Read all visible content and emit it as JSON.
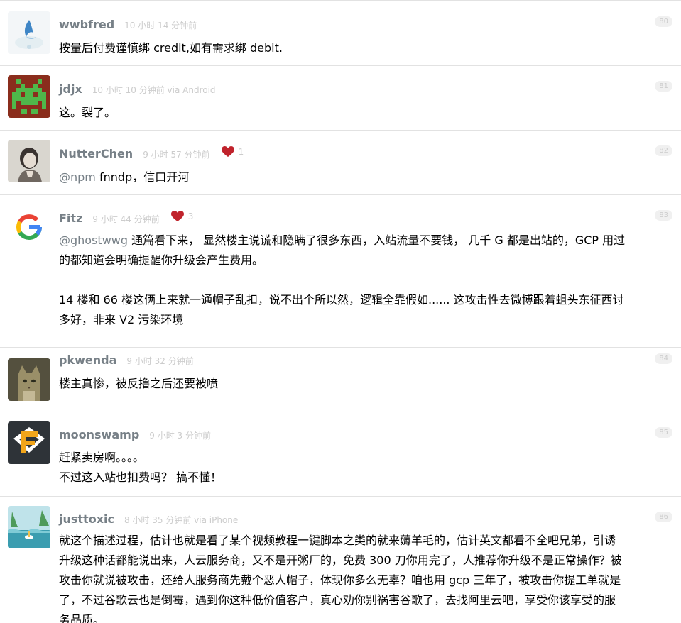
{
  "replies": [
    {
      "username": "wwbfred",
      "time": "10 小时 14 分钟前",
      "floor": "80",
      "content": [
        "按量后付费谨慎绑 credit,如有需求绑 debit."
      ]
    },
    {
      "username": "jdjx",
      "time": "10 小时 10 分钟前 via Android",
      "floor": "81",
      "content": [
        "这。裂了。"
      ]
    },
    {
      "username": "NutterChen",
      "time": "9 小时 57 分钟前",
      "likes": "1",
      "floor": "82",
      "mention": "@npm",
      "content": [
        " fnndp，信口开河"
      ]
    },
    {
      "username": "Fitz",
      "time": "9 小时 44 分钟前",
      "likes": "3",
      "floor": "83",
      "mention": "@ghostwwg",
      "content": [
        " 通篇看下来， 显然楼主说谎和隐瞒了很多东西，入站流量不要钱， 几千 G 都是出站的，GCP 用过",
        "的都知道会明确提醒你升级会产生费用。",
        "",
        "14 楼和 66 楼这俩上来就一通帽子乱扣，说不出个所以然，逻辑全靠假如...... 这攻击性去微博跟着蛆头东征西讨",
        "多好，非来 V2 污染环境"
      ]
    },
    {
      "username": "pkwenda",
      "time": "9 小时 32 分钟前",
      "floor": "84",
      "content": [
        "楼主真惨，被反撸之后还要被喷"
      ]
    },
    {
      "username": "moonswamp",
      "time": "9 小时 3 分钟前",
      "floor": "85",
      "content": [
        "赶紧卖房啊。。。。",
        "不过这入站也扣费吗？ 搞不懂！"
      ]
    },
    {
      "username": "justtoxic",
      "time": "8 小时 35 分钟前 via iPhone",
      "floor": "86",
      "content": [
        "就这个描述过程，估计也就是看了某个视频教程一键脚本之类的就来薅羊毛的，估计英文都看不全吧兄弟，引诱",
        "升级这种话都能说出来，人云服务商，又不是开粥厂的，免费 300 刀你用完了，人推荐你升级不是正常操作？被",
        "攻击你就说被攻击，还给人服务商先戴个恶人帽子，体现你多么无辜？咱也用 gcp 三年了，被攻击你提工单就是",
        "了，不过谷歌云也是倒霉，遇到你这种低价值客户，真心劝你别祸害谷歌了，去找阿里云吧，享受你该享受的服",
        "务品质。"
      ]
    }
  ]
}
